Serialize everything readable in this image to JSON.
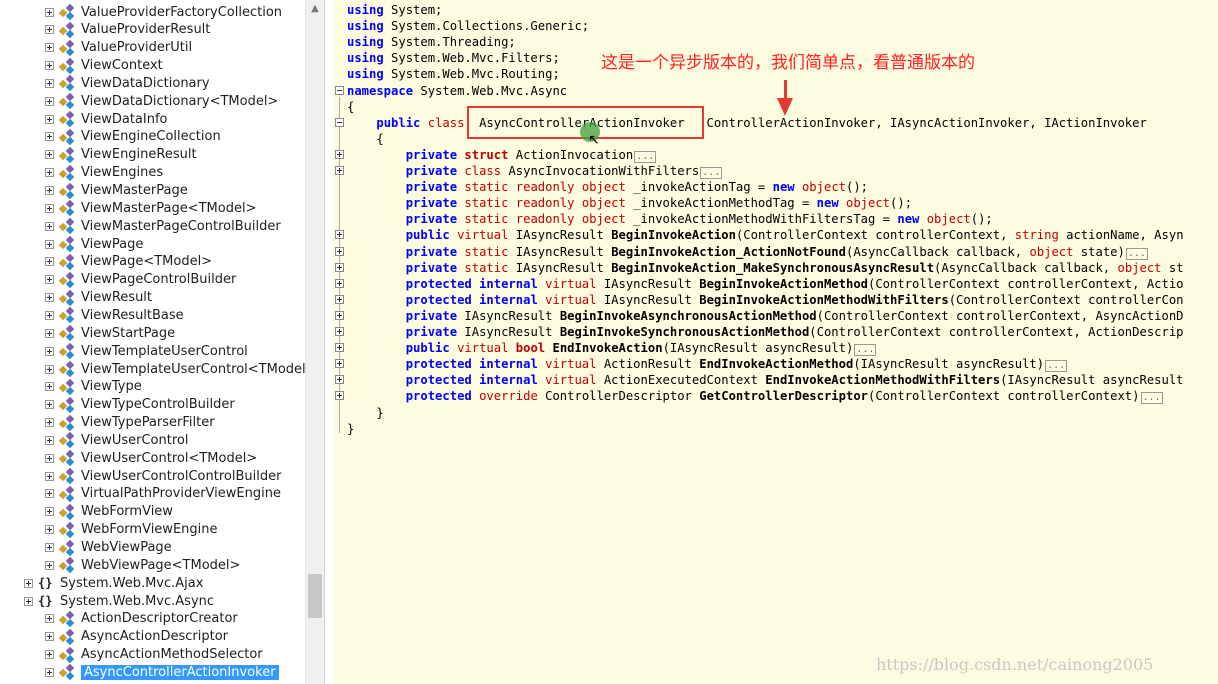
{
  "tree": {
    "items": [
      {
        "label": "ValueProviderFactoryCollection",
        "kind": "class"
      },
      {
        "label": "ValueProviderResult",
        "kind": "class"
      },
      {
        "label": "ValueProviderUtil",
        "kind": "class"
      },
      {
        "label": "ViewContext",
        "kind": "class"
      },
      {
        "label": "ViewDataDictionary",
        "kind": "class"
      },
      {
        "label": "ViewDataDictionary<TModel>",
        "kind": "class"
      },
      {
        "label": "ViewDataInfo",
        "kind": "class"
      },
      {
        "label": "ViewEngineCollection",
        "kind": "class"
      },
      {
        "label": "ViewEngineResult",
        "kind": "class"
      },
      {
        "label": "ViewEngines",
        "kind": "class"
      },
      {
        "label": "ViewMasterPage",
        "kind": "class"
      },
      {
        "label": "ViewMasterPage<TModel>",
        "kind": "class"
      },
      {
        "label": "ViewMasterPageControlBuilder",
        "kind": "class"
      },
      {
        "label": "ViewPage",
        "kind": "class"
      },
      {
        "label": "ViewPage<TModel>",
        "kind": "class"
      },
      {
        "label": "ViewPageControlBuilder",
        "kind": "class"
      },
      {
        "label": "ViewResult",
        "kind": "class"
      },
      {
        "label": "ViewResultBase",
        "kind": "class"
      },
      {
        "label": "ViewStartPage",
        "kind": "class"
      },
      {
        "label": "ViewTemplateUserControl",
        "kind": "class"
      },
      {
        "label": "ViewTemplateUserControl<TModel",
        "kind": "class"
      },
      {
        "label": "ViewType",
        "kind": "class"
      },
      {
        "label": "ViewTypeControlBuilder",
        "kind": "class"
      },
      {
        "label": "ViewTypeParserFilter",
        "kind": "class"
      },
      {
        "label": "ViewUserControl",
        "kind": "class"
      },
      {
        "label": "ViewUserControl<TModel>",
        "kind": "class"
      },
      {
        "label": "ViewUserControlControlBuilder",
        "kind": "class"
      },
      {
        "label": "VirtualPathProviderViewEngine",
        "kind": "class"
      },
      {
        "label": "WebFormView",
        "kind": "class"
      },
      {
        "label": "WebFormViewEngine",
        "kind": "class"
      },
      {
        "label": "WebViewPage",
        "kind": "class"
      },
      {
        "label": "WebViewPage<TModel>",
        "kind": "class"
      },
      {
        "label": "System.Web.Mvc.Ajax",
        "kind": "namespace"
      },
      {
        "label": "System.Web.Mvc.Async",
        "kind": "namespace"
      },
      {
        "label": "ActionDescriptorCreator",
        "kind": "class"
      },
      {
        "label": "AsyncActionDescriptor",
        "kind": "class"
      },
      {
        "label": "AsyncActionMethodSelector",
        "kind": "class"
      },
      {
        "label": "AsyncControllerActionInvoker",
        "kind": "class",
        "selected": true
      }
    ],
    "namespace_icon": "{}"
  },
  "code": {
    "lines": [
      {
        "segments": [
          {
            "t": "using",
            "c": "kw"
          },
          {
            "t": " System;"
          }
        ]
      },
      {
        "segments": [
          {
            "t": "using",
            "c": "kw"
          },
          {
            "t": " System.Collections.Generic;"
          }
        ]
      },
      {
        "segments": [
          {
            "t": "using",
            "c": "kw"
          },
          {
            "t": " System.Threading;"
          }
        ]
      },
      {
        "segments": [
          {
            "t": "using",
            "c": "kw"
          },
          {
            "t": " System.Web.Mvc.Filters;"
          }
        ]
      },
      {
        "segments": [
          {
            "t": "using",
            "c": "kw"
          },
          {
            "t": " System.Web.Mvc.Routing;"
          }
        ]
      },
      {
        "segments": [
          {
            "t": "namespace",
            "c": "kw"
          },
          {
            "t": " System.Web.Mvc.Async"
          }
        ]
      },
      {
        "segments": [
          {
            "t": "{"
          }
        ]
      },
      {
        "segments": [
          {
            "t": "    "
          },
          {
            "t": "public",
            "c": "kw"
          },
          {
            "t": " "
          },
          {
            "t": "class",
            "c": "kr2"
          },
          {
            "t": "  AsyncControllerActionInvoker   ControllerActionInvoker, IAsyncActionInvoker, IActionInvoker"
          }
        ]
      },
      {
        "segments": [
          {
            "t": "    {"
          }
        ]
      },
      {
        "segments": [
          {
            "t": "        "
          },
          {
            "t": "private",
            "c": "kw"
          },
          {
            "t": " "
          },
          {
            "t": "struct",
            "c": "kr"
          },
          {
            "t": " ActionInvocation"
          },
          {
            "t": "...",
            "c": "fold"
          }
        ]
      },
      {
        "segments": [
          {
            "t": "        "
          },
          {
            "t": "private",
            "c": "kw"
          },
          {
            "t": " "
          },
          {
            "t": "class",
            "c": "kr2"
          },
          {
            "t": " AsyncInvocationWithFilters"
          },
          {
            "t": "...",
            "c": "fold"
          }
        ]
      },
      {
        "segments": [
          {
            "t": "        "
          },
          {
            "t": "private",
            "c": "kw"
          },
          {
            "t": " "
          },
          {
            "t": "static readonly object",
            "c": "kr2"
          },
          {
            "t": " _invokeActionTag = "
          },
          {
            "t": "new",
            "c": "kw"
          },
          {
            "t": " "
          },
          {
            "t": "object",
            "c": "kr2"
          },
          {
            "t": "();"
          }
        ]
      },
      {
        "segments": [
          {
            "t": "        "
          },
          {
            "t": "private",
            "c": "kw"
          },
          {
            "t": " "
          },
          {
            "t": "static readonly object",
            "c": "kr2"
          },
          {
            "t": " _invokeActionMethodTag = "
          },
          {
            "t": "new",
            "c": "kw"
          },
          {
            "t": " "
          },
          {
            "t": "object",
            "c": "kr2"
          },
          {
            "t": "();"
          }
        ]
      },
      {
        "segments": [
          {
            "t": "        "
          },
          {
            "t": "private",
            "c": "kw"
          },
          {
            "t": " "
          },
          {
            "t": "static readonly object",
            "c": "kr2"
          },
          {
            "t": " _invokeActionMethodWithFiltersTag = "
          },
          {
            "t": "new",
            "c": "kw"
          },
          {
            "t": " "
          },
          {
            "t": "object",
            "c": "kr2"
          },
          {
            "t": "();"
          }
        ]
      },
      {
        "segments": [
          {
            "t": "        "
          },
          {
            "t": "public",
            "c": "kw"
          },
          {
            "t": " "
          },
          {
            "t": "virtual",
            "c": "kr2"
          },
          {
            "t": " IAsyncResult "
          },
          {
            "t": "BeginInvokeAction",
            "c": "fn"
          },
          {
            "t": "(ControllerContext controllerContext, "
          },
          {
            "t": "string",
            "c": "kr2"
          },
          {
            "t": " actionName, Asyn"
          }
        ]
      },
      {
        "segments": [
          {
            "t": "        "
          },
          {
            "t": "private",
            "c": "kw"
          },
          {
            "t": " "
          },
          {
            "t": "static",
            "c": "kr2"
          },
          {
            "t": " IAsyncResult "
          },
          {
            "t": "BeginInvokeAction_ActionNotFound",
            "c": "fn"
          },
          {
            "t": "(AsyncCallback callback, "
          },
          {
            "t": "object",
            "c": "kr2"
          },
          {
            "t": " state)"
          },
          {
            "t": "...",
            "c": "fold"
          }
        ]
      },
      {
        "segments": [
          {
            "t": "        "
          },
          {
            "t": "private",
            "c": "kw"
          },
          {
            "t": " "
          },
          {
            "t": "static",
            "c": "kr2"
          },
          {
            "t": " IAsyncResult "
          },
          {
            "t": "BeginInvokeAction_MakeSynchronousAsyncResult",
            "c": "fn"
          },
          {
            "t": "(AsyncCallback callback, "
          },
          {
            "t": "object",
            "c": "kr2"
          },
          {
            "t": " st"
          }
        ]
      },
      {
        "segments": [
          {
            "t": "        "
          },
          {
            "t": "protected internal",
            "c": "kw"
          },
          {
            "t": " "
          },
          {
            "t": "virtual",
            "c": "kr2"
          },
          {
            "t": " IAsyncResult "
          },
          {
            "t": "BeginInvokeActionMethod",
            "c": "fn"
          },
          {
            "t": "(ControllerContext controllerContext, Actio"
          }
        ]
      },
      {
        "segments": [
          {
            "t": "        "
          },
          {
            "t": "protected internal",
            "c": "kw"
          },
          {
            "t": " "
          },
          {
            "t": "virtual",
            "c": "kr2"
          },
          {
            "t": " IAsyncResult "
          },
          {
            "t": "BeginInvokeActionMethodWithFilters",
            "c": "fn"
          },
          {
            "t": "(ControllerContext controllerCon"
          }
        ]
      },
      {
        "segments": [
          {
            "t": "        "
          },
          {
            "t": "private",
            "c": "kw"
          },
          {
            "t": " IAsyncResult "
          },
          {
            "t": "BeginInvokeAsynchronousActionMethod",
            "c": "fn"
          },
          {
            "t": "(ControllerContext controllerContext, AsyncActionD"
          }
        ]
      },
      {
        "segments": [
          {
            "t": "        "
          },
          {
            "t": "private",
            "c": "kw"
          },
          {
            "t": " IAsyncResult "
          },
          {
            "t": "BeginInvokeSynchronousActionMethod",
            "c": "fn"
          },
          {
            "t": "(ControllerContext controllerContext, ActionDescrip"
          }
        ]
      },
      {
        "segments": [
          {
            "t": "        "
          },
          {
            "t": "public",
            "c": "kw"
          },
          {
            "t": " "
          },
          {
            "t": "virtual",
            "c": "kr2"
          },
          {
            "t": " "
          },
          {
            "t": "bool",
            "c": "kr"
          },
          {
            "t": " "
          },
          {
            "t": "EndInvokeAction",
            "c": "fn"
          },
          {
            "t": "(IAsyncResult asyncResult)"
          },
          {
            "t": "...",
            "c": "fold"
          }
        ]
      },
      {
        "segments": [
          {
            "t": "        "
          },
          {
            "t": "protected internal",
            "c": "kw"
          },
          {
            "t": " "
          },
          {
            "t": "virtual",
            "c": "kr2"
          },
          {
            "t": " ActionResult "
          },
          {
            "t": "EndInvokeActionMethod",
            "c": "fn"
          },
          {
            "t": "(IAsyncResult asyncResult)"
          },
          {
            "t": "...",
            "c": "fold"
          }
        ]
      },
      {
        "segments": [
          {
            "t": "        "
          },
          {
            "t": "protected internal",
            "c": "kw"
          },
          {
            "t": " "
          },
          {
            "t": "virtual",
            "c": "kr2"
          },
          {
            "t": " ActionExecutedContext "
          },
          {
            "t": "EndInvokeActionMethodWithFilters",
            "c": "fn"
          },
          {
            "t": "(IAsyncResult asyncResult"
          }
        ]
      },
      {
        "segments": [
          {
            "t": "        "
          },
          {
            "t": "protected",
            "c": "kw"
          },
          {
            "t": " "
          },
          {
            "t": "override",
            "c": "kr2"
          },
          {
            "t": " ControllerDescriptor "
          },
          {
            "t": "GetControllerDescriptor",
            "c": "fn"
          },
          {
            "t": "(ControllerContext controllerContext)"
          },
          {
            "t": "...",
            "c": "fold"
          }
        ]
      },
      {
        "segments": [
          {
            "t": "    }"
          }
        ]
      },
      {
        "segments": [
          {
            "t": "}"
          }
        ]
      }
    ],
    "gutter": [
      {
        "line": 5,
        "type": "minus"
      },
      {
        "line": 7,
        "type": "minus"
      },
      {
        "line": 9,
        "type": "plus"
      },
      {
        "line": 10,
        "type": "plus"
      },
      {
        "line": 14,
        "type": "plus"
      },
      {
        "line": 15,
        "type": "plus"
      },
      {
        "line": 16,
        "type": "plus"
      },
      {
        "line": 17,
        "type": "plus"
      },
      {
        "line": 18,
        "type": "plus"
      },
      {
        "line": 19,
        "type": "plus"
      },
      {
        "line": 20,
        "type": "plus"
      },
      {
        "line": 21,
        "type": "plus"
      },
      {
        "line": 22,
        "type": "plus"
      },
      {
        "line": 23,
        "type": "plus"
      },
      {
        "line": 24,
        "type": "plus"
      }
    ]
  },
  "annotation": {
    "text": "这是一个异步版本的，我们简单点，看普通版本的",
    "color": "#ff2020"
  },
  "watermark": "https://blog.csdn.net/cainong2005",
  "colors": {
    "code_background": "#fdfce0",
    "keyword_blue": "#0000ff",
    "keyword_red": "#c00000",
    "selection": "#3399ff",
    "highlight_box": "#e53935"
  }
}
